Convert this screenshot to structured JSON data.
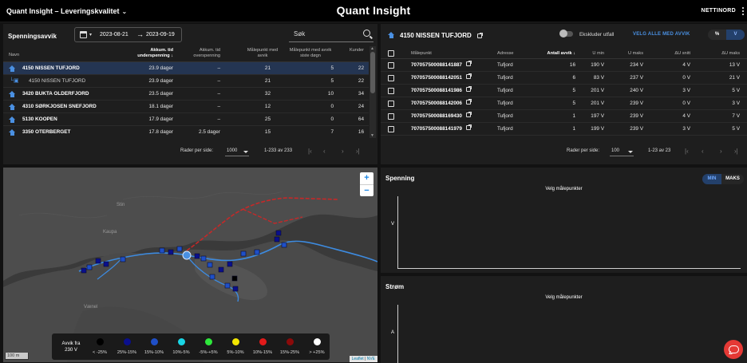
{
  "header": {
    "app_title": "Quant Insight – Leveringskvalitet",
    "brand": "Quant Insight",
    "org": "NETTINORD"
  },
  "left_panel": {
    "title": "Spenningsavvik",
    "date_from": "2023-08-21",
    "date_arrow": "→",
    "date_to": "2023-09-19",
    "search_placeholder": "Søk",
    "columns": {
      "name": "Navn",
      "under_1": "Akkum. tid",
      "under_2": "underspenning ↓",
      "over_1": "Akkum. tid",
      "over_2": "overspenning",
      "mp_1": "Målepunkt med",
      "mp_2": "avvik",
      "mp7_1": "Målepunkt med avvik",
      "mp7_2": "siste døgn",
      "cust": "Kunder"
    },
    "rows": [
      {
        "name": "4150 NISSEN TUFJORD",
        "under": "23.9 dager",
        "over": "–",
        "mp": "21",
        "mp7": "5",
        "cust": "22",
        "selected": true,
        "child": false
      },
      {
        "name": "4150 NISSEN TUFJORD",
        "under": "23.9 dager",
        "over": "–",
        "mp": "21",
        "mp7": "5",
        "cust": "22",
        "selected": false,
        "child": true
      },
      {
        "name": "3420 BUKTA OLDERFJORD",
        "under": "23.5 dager",
        "over": "–",
        "mp": "32",
        "mp7": "10",
        "cust": "34",
        "selected": false,
        "child": false
      },
      {
        "name": "4310 SØRKJOSEN SNEFJORD",
        "under": "18.1 dager",
        "over": "–",
        "mp": "12",
        "mp7": "0",
        "cust": "24",
        "selected": false,
        "child": false
      },
      {
        "name": "5130 KOOPEN",
        "under": "17.9 dager",
        "over": "–",
        "mp": "25",
        "mp7": "0",
        "cust": "64",
        "selected": false,
        "child": false
      },
      {
        "name": "3350 OTERBERGET",
        "under": "17.8 dager",
        "over": "2.5 dager",
        "mp": "15",
        "mp7": "7",
        "cust": "16",
        "selected": false,
        "child": false
      }
    ],
    "pager": {
      "rows_label": "Rader per side:",
      "rows_value": "1000",
      "range": "1-233 av 233"
    }
  },
  "right_panel": {
    "title": "4150 NISSEN TUFJORD",
    "toggle_label": "Ekskluder utfall",
    "select_all": "VELG ALLE MED AVVIK",
    "unit_a": "%",
    "unit_b": "V",
    "columns": {
      "mp": "Målepunkt",
      "addr": "Adresse",
      "count": "Antall avvik ↓",
      "umin": "U min",
      "umax": "U maks",
      "davg": "ΔU snitt",
      "dmax": "ΔU maks"
    },
    "rows": [
      {
        "mp": "707057500088141887",
        "addr": "Tufjord",
        "count": "16",
        "umin": "190 V",
        "umax": "234 V",
        "davg": "4 V",
        "dmax": "13 V"
      },
      {
        "mp": "707057500088142051",
        "addr": "Tufjord",
        "count": "6",
        "umin": "83 V",
        "umax": "237 V",
        "davg": "0 V",
        "dmax": "21 V"
      },
      {
        "mp": "707057500088141986",
        "addr": "Tufjord",
        "count": "5",
        "umin": "201 V",
        "umax": "240 V",
        "davg": "3 V",
        "dmax": "5 V"
      },
      {
        "mp": "707057500088142006",
        "addr": "Tufjord",
        "count": "5",
        "umin": "201 V",
        "umax": "239 V",
        "davg": "0 V",
        "dmax": "3 V"
      },
      {
        "mp": "707057500088169430",
        "addr": "Tufjord",
        "count": "1",
        "umin": "197 V",
        "umax": "239 V",
        "davg": "4 V",
        "dmax": "7 V"
      },
      {
        "mp": "707057500088141979",
        "addr": "Tufjord",
        "count": "1",
        "umin": "199 V",
        "umax": "239 V",
        "davg": "3 V",
        "dmax": "5 V"
      }
    ],
    "pager": {
      "rows_label": "Rader per side:",
      "rows_value": "100",
      "range": "1-23 av 23"
    }
  },
  "map": {
    "zoom_in": "+",
    "zoom_out": "−",
    "scale": "100 m",
    "attribution_leaflet": "Leaflet",
    "attribution_sep": " | ",
    "attribution_src": "NVE",
    "place_labels": [
      "Stin",
      "Kaupa",
      "Vænel"
    ],
    "legend": {
      "title_1": "Avvik fra",
      "title_2": "230 V",
      "items": [
        {
          "label": "< -25%",
          "color": "#000000"
        },
        {
          "label": "25%-15%",
          "color": "#0a0f8c"
        },
        {
          "label": "15%-10%",
          "color": "#1f4fc7"
        },
        {
          "label": "10%-5%",
          "color": "#19d6e6"
        },
        {
          "label": "-5%-+5%",
          "color": "#2ee83b"
        },
        {
          "label": "5%-10%",
          "color": "#f2e600"
        },
        {
          "label": "10%-15%",
          "color": "#e31a1a"
        },
        {
          "label": "15%-25%",
          "color": "#8b0a0a"
        },
        {
          "label": "> +25%",
          "color": "#ffffff"
        }
      ]
    }
  },
  "chart_voltage": {
    "title": "Spenning",
    "min_label": "MIN",
    "max_label": "MAKS",
    "message": "Velg målepunkter",
    "ylabel": "V"
  },
  "chart_current": {
    "title": "Strøm",
    "message": "Velg målepunkter",
    "ylabel": "A"
  },
  "colors": {
    "accent": "#4a90e2",
    "selected_row": "#243552",
    "chat": "#e53935"
  }
}
